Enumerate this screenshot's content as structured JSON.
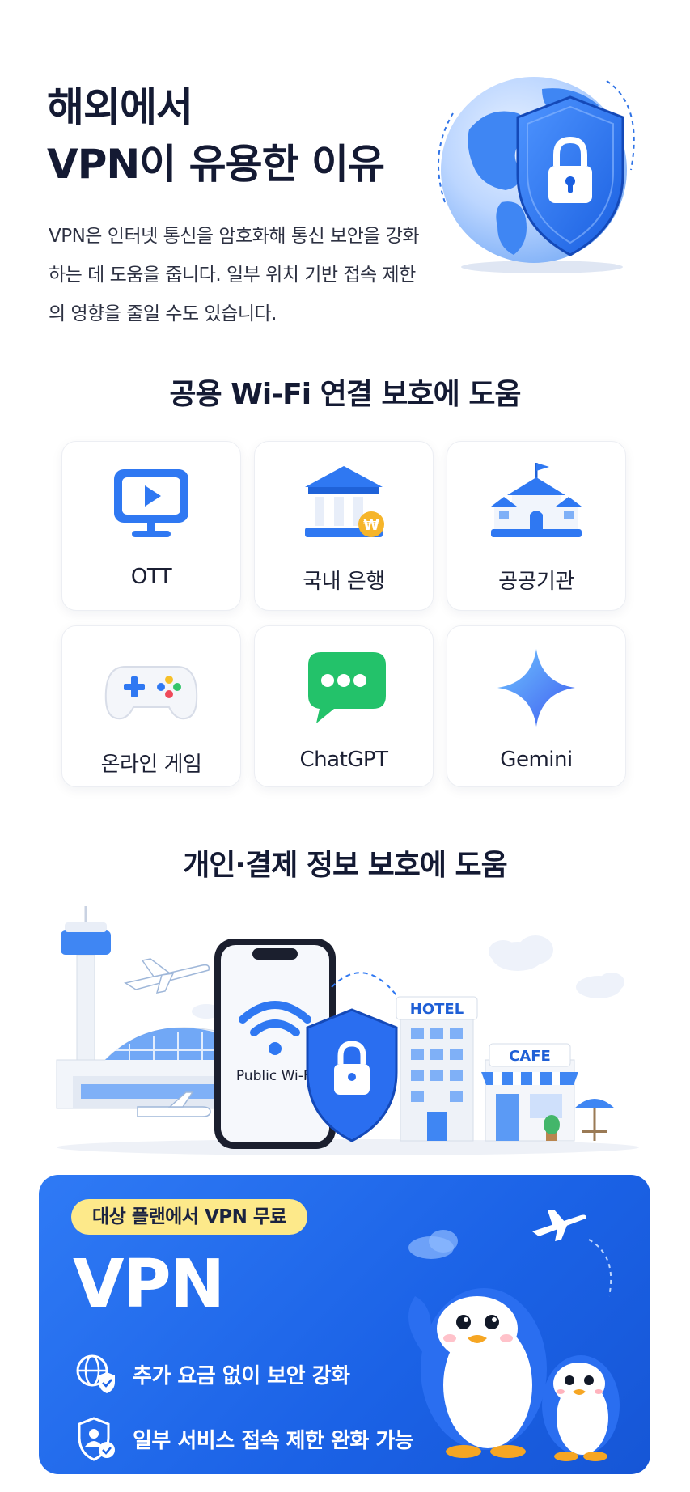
{
  "hero": {
    "title_line1": "해외에서",
    "title_line2": "VPN이 유용한 이유",
    "description": "VPN은 인터넷 통신을 암호화해 통신 보안을 강화하는 데 도움을 줍니다. 일부 위치 기반 접속 제한의 영향을 줄일 수도 있습니다.",
    "icon": "globe-shield-lock-icon"
  },
  "section1": {
    "title": "공용 Wi-Fi 연결 보호에 도움",
    "items": [
      {
        "label": "OTT",
        "icon": "monitor-play-icon"
      },
      {
        "label": "국내 은행",
        "icon": "bank-won-icon"
      },
      {
        "label": "공공기관",
        "icon": "public-building-icon"
      },
      {
        "label": "온라인 게임",
        "icon": "gamepad-icon"
      },
      {
        "label": "ChatGPT",
        "icon": "chat-bubble-icon"
      },
      {
        "label": "Gemini",
        "icon": "sparkle-star-icon"
      }
    ]
  },
  "section2": {
    "title": "개인·결제 정보 보호에 도움",
    "phone_label": "Public Wi-Fi",
    "hotel_sign": "HOTEL",
    "cafe_sign": "CAFE"
  },
  "promo": {
    "badge": "대상 플랜에서 VPN 무료",
    "title": "VPN",
    "features": [
      {
        "text": "추가 요금 없이 보안 강화",
        "icon": "globe-shield-icon"
      },
      {
        "text": "일부 서비스 접속 제한 완화 가능",
        "icon": "user-shield-icon"
      }
    ],
    "mascot": "penguin-mascot-icon"
  },
  "colors": {
    "primary_blue": "#1b62e6",
    "badge_yellow": "#fde98a",
    "text_dark": "#141a33"
  }
}
